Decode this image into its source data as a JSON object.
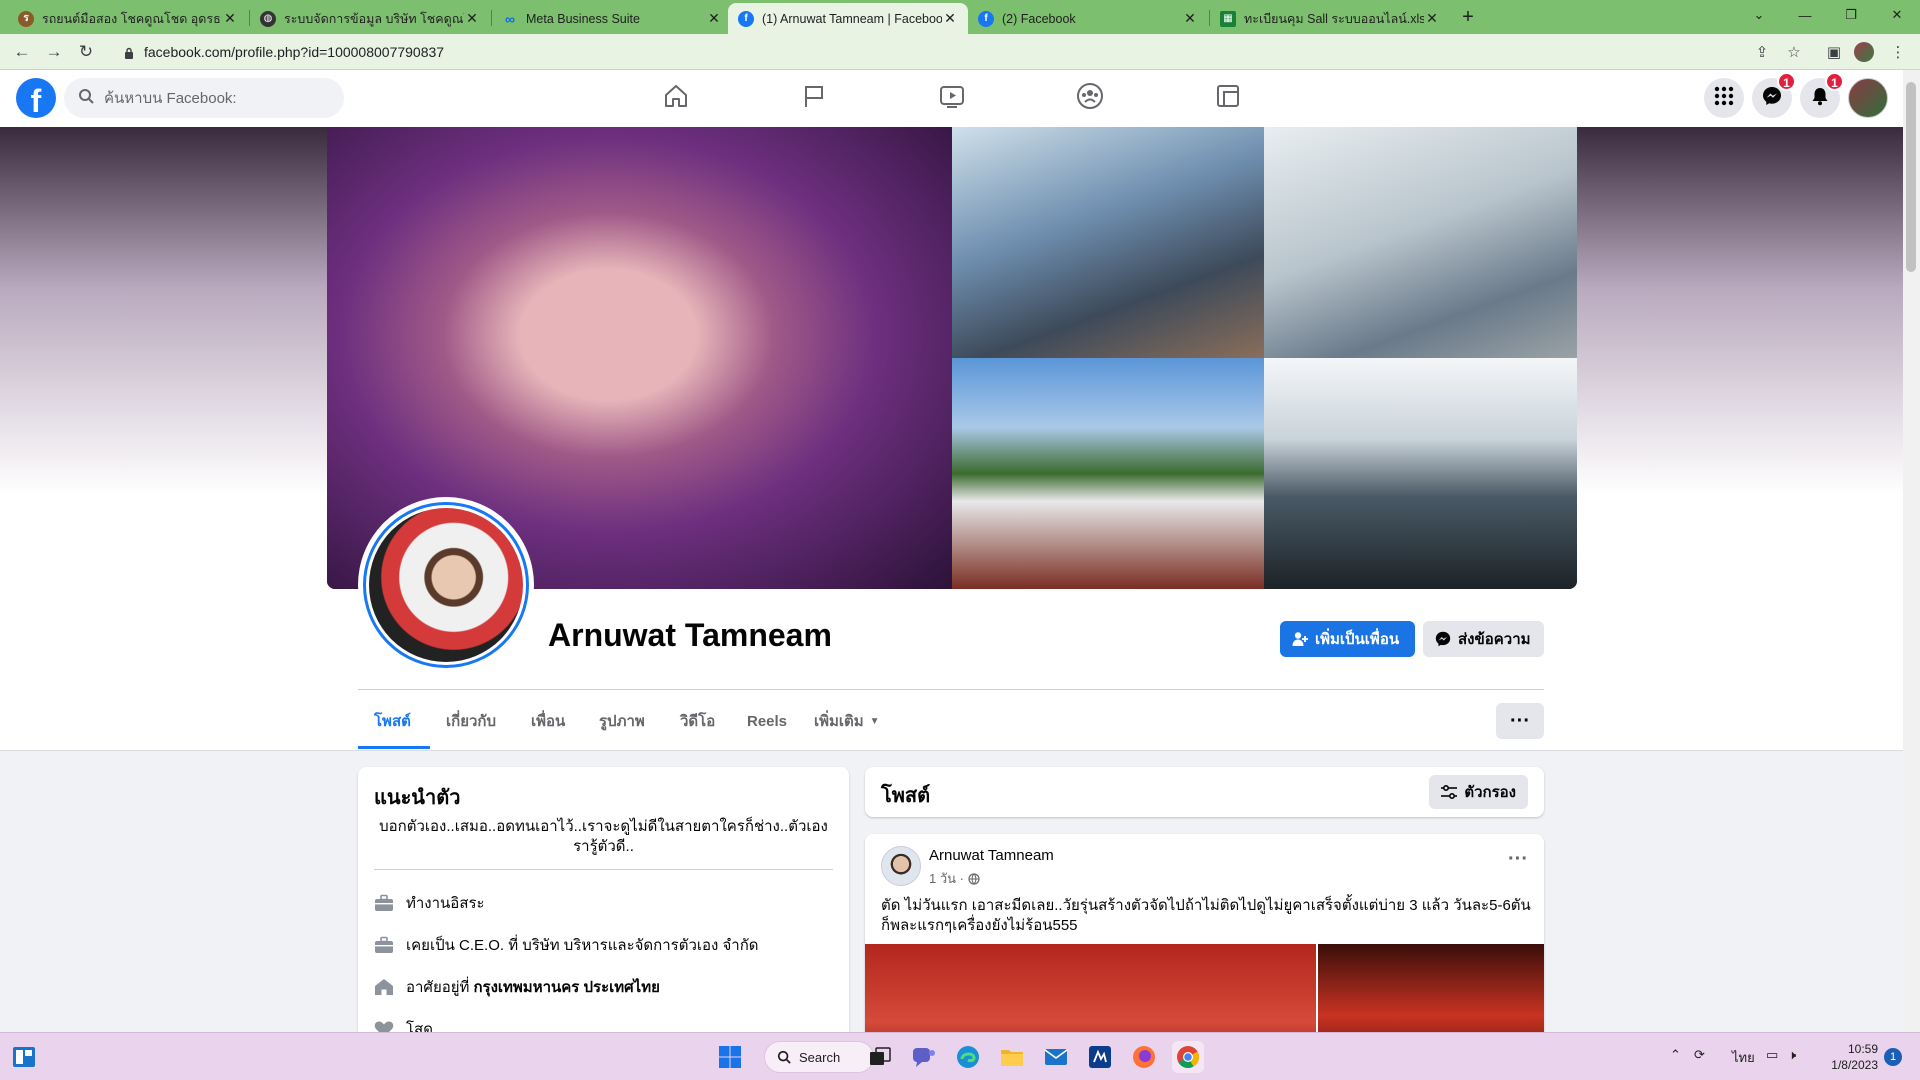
{
  "browser": {
    "tabs": [
      {
        "title": "รถยนต์มือสอง โชคดูณโชด อุดรธานี",
        "icon": "site-icon"
      },
      {
        "title": "ระบบจัดการข้อมูล บริษัท โชคดูณโชด ...",
        "icon": "globe-icon"
      },
      {
        "title": "Meta Business Suite",
        "icon": "meta-icon"
      },
      {
        "title": "(1) Arnuwat Tamneam | Facebook",
        "icon": "facebook-icon",
        "active": true
      },
      {
        "title": "(2) Facebook",
        "icon": "facebook-icon"
      },
      {
        "title": "ทะเบียนคุม Sall ระบบออนไลน์.xlsx - G...",
        "icon": "sheets-icon"
      }
    ],
    "url": "facebook.com/profile.php?id=100008007790837",
    "new_tab_label": "+",
    "window_minimize": "—",
    "window_restore": "❐",
    "window_close": "✕",
    "tab_list_label": "⌄"
  },
  "facebook": {
    "search_placeholder": "ค้นหาบน Facebook:",
    "nav": [
      "home-icon",
      "pages-flag-icon",
      "watch-video-icon",
      "groups-icon",
      "gaming-icon"
    ],
    "messenger_badge": "1",
    "notifications_badge": "1",
    "brand_color": "#1877f2"
  },
  "profile": {
    "name": "Arnuwat Tamneam",
    "add_friend_label": "เพิ่มเป็นเพื่อน",
    "message_label": "ส่งข้อความ",
    "tabs": [
      "โพสต์",
      "เกี่ยวกับ",
      "เพื่อน",
      "รูปภาพ",
      "วิดีโอ",
      "Reels",
      "เพิ่มเติม"
    ],
    "more_label": "···"
  },
  "intro": {
    "title": "แนะนำตัว",
    "bio": "บอกตัวเอง..เสมอ..อดทนเอาไว้..เราจะดูไม่ดีในสายตาใครก็ช่าง..ตัวเองรารู้ตัวดี..",
    "items": [
      {
        "icon": "briefcase-icon",
        "text": "ทำงานอิสระ",
        "bold": ""
      },
      {
        "icon": "briefcase-icon",
        "text": "เคยเป็น C.E.O. ที่ บริษัท บริหารและจัดการตัวเอง จำกัด",
        "bold": ""
      },
      {
        "icon": "home-icon",
        "text": "อาศัยอยู่ที่",
        "bold": "กรุงเทพมหานคร ประเทศไทย"
      },
      {
        "icon": "heart-icon",
        "text": "โสด",
        "bold": ""
      }
    ]
  },
  "posts": {
    "title": "โพสต์",
    "filter_label": "ตัวกรอง",
    "post": {
      "author": "Arnuwat Tamneam",
      "time": "1 วัน ·",
      "privacy_icon": "globe-icon",
      "text": "ตัด ไม่วันแรก เอาสะมีดเลย..วัยรุ่นสร้างตัวจัดไปถ้าไม่ติดไปดูไม่ยูคาเสร็จตั้งแต่บ่าย 3 แล้ว วันละ5-6ตันก็พละแรกๆเครื่องยังไม่ร้อน555",
      "more_label": "···"
    }
  },
  "taskbar": {
    "search_label": "Search",
    "language": "ไทย",
    "time": "10:59",
    "date": "1/8/2023",
    "notification_count": "1"
  }
}
